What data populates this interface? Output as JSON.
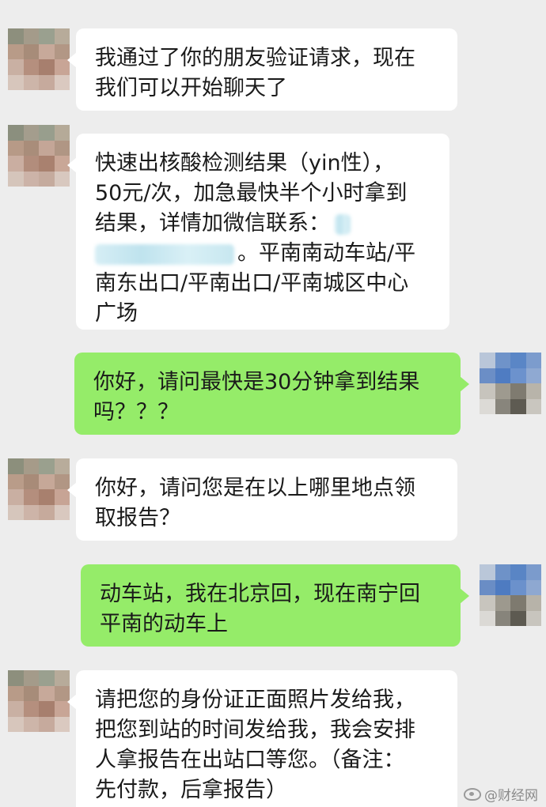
{
  "colors": {
    "background": "#ededed",
    "incoming_bubble": "#ffffff",
    "outgoing_bubble": "#95ec69",
    "text": "#1a1a1a"
  },
  "messages": [
    {
      "direction": "incoming",
      "lines": [
        "我通过了你的朋友验证请求，现在",
        "我们可以开始聊天了"
      ]
    },
    {
      "direction": "incoming",
      "lines": [
        "快速出核酸检测结果（yin性），",
        "50元/次，加急最快半个小时拿到",
        "结果，详情加微信联系：",
        "。平南南动车站/平",
        "南东出口/平南出口/平南城区中心",
        "广场"
      ]
    },
    {
      "direction": "outgoing",
      "lines": [
        "你好，请问最快是30分钟拿到结果",
        "吗？？？"
      ]
    },
    {
      "direction": "incoming",
      "lines": [
        "你好，请问您是在以上哪里地点领",
        "取报告？"
      ]
    },
    {
      "direction": "outgoing",
      "lines": [
        "动车站，我在北京回，现在南宁回",
        "平南的动车上"
      ]
    },
    {
      "direction": "incoming",
      "lines": [
        "请把您的身份证正面照片发给我，",
        "把您到站的时间发给我，我会安排",
        "人拿报告在出站口等您。（备注：",
        "先付款，后拿报告）"
      ]
    }
  ],
  "watermark": {
    "icon": "weibo-icon",
    "text": "@财经网"
  }
}
